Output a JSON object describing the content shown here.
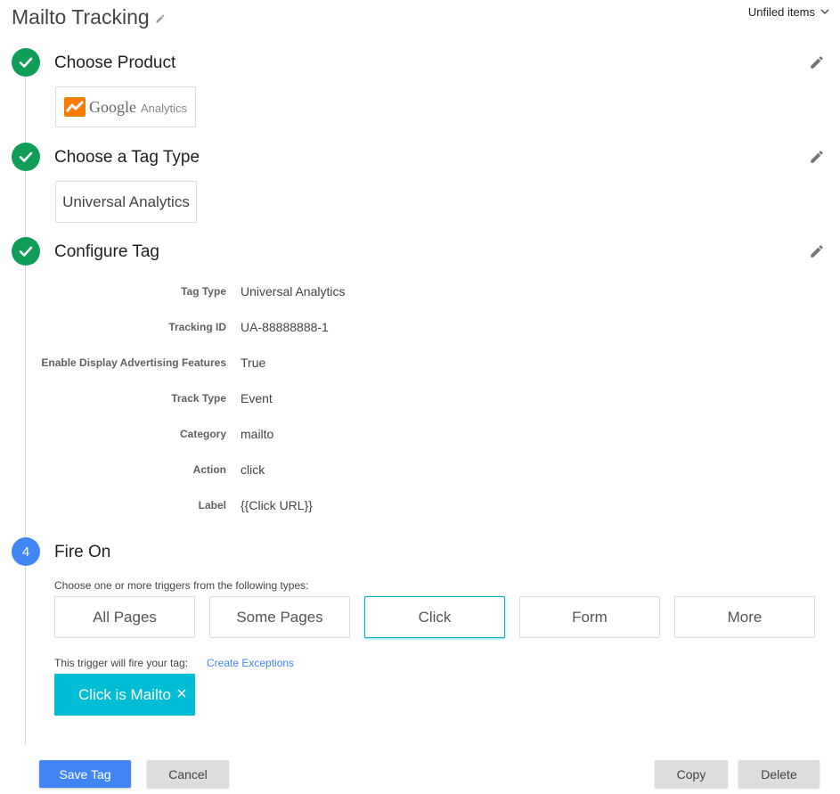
{
  "header": {
    "title": "Mailto Tracking",
    "folder": "Unfiled items"
  },
  "steps": [
    {
      "title": "Choose Product",
      "status": "complete"
    },
    {
      "title": "Choose a Tag Type",
      "status": "complete"
    },
    {
      "title": "Configure Tag",
      "status": "complete"
    },
    {
      "title": "Fire On",
      "status": "current",
      "number": "4"
    }
  ],
  "product": {
    "logo_word": "Google",
    "logo_sub": "Analytics"
  },
  "tag_type": "Universal Analytics",
  "config": [
    {
      "label": "Tag Type",
      "value": "Universal Analytics"
    },
    {
      "label": "Tracking ID",
      "value": "UA-88888888-1"
    },
    {
      "label": "Enable Display Advertising Features",
      "value": "True"
    },
    {
      "label": "Track Type",
      "value": "Event"
    },
    {
      "label": "Category",
      "value": "mailto"
    },
    {
      "label": "Action",
      "value": "click"
    },
    {
      "label": "Label",
      "value": "{{Click URL}}"
    }
  ],
  "fire_on": {
    "instructions": "Choose one or more triggers from the following types:",
    "triggers": [
      "All Pages",
      "Some Pages",
      "Click",
      "Form",
      "More"
    ],
    "selected": "Click",
    "fire_text": "This trigger will fire your tag:",
    "exceptions_link": "Create Exceptions",
    "chip": "Click is Mailto"
  },
  "buttons": {
    "save": "Save Tag",
    "cancel": "Cancel",
    "copy": "Copy",
    "delete": "Delete"
  },
  "colors": {
    "complete": "#0f9d58",
    "current": "#4285f4",
    "primary": "#4285f4",
    "accent": "#00bcd4",
    "link": "#4285f4"
  },
  "icons": [
    "pencil-icon",
    "chevron-down-icon",
    "check-icon",
    "close-icon",
    "google-analytics-logo"
  ]
}
